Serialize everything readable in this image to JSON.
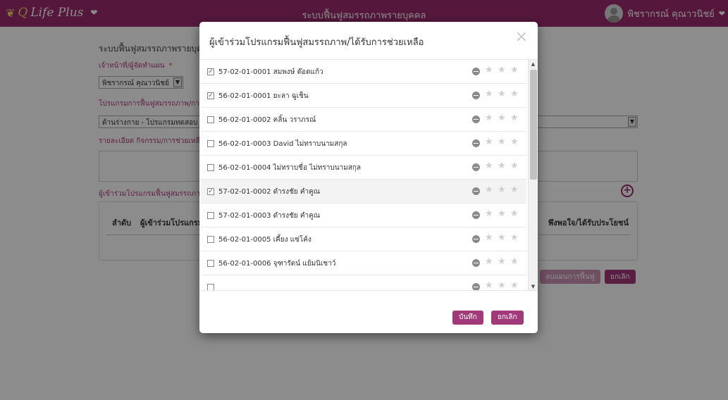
{
  "brand": {
    "name": "QLife Plus",
    "q": "Q",
    "rest": "Life Plus"
  },
  "header": {
    "app_title": "ระบบฟื้นฟูสมรรถภาพรายบุคคล",
    "user_name": "พิชรากรณ์ คุณาวนิชย์"
  },
  "form": {
    "heading": "ระบบฟื้นฟูสมรรถภาพรายบุค",
    "officer_label": "เจ้าหน้าที่/ผู้จัดทำแผน",
    "required_mark": "*",
    "officer_value": "พิชรากรณ์ คุณาวนิชย์",
    "program_label": "โปรแกรมการฟื้นฟูสมรรถภาพ/การช",
    "program_value": "ด้านร่างกาย - โปรแกรมทดสอบ",
    "detail_label": "รายละเอียด กิจกรรม/การช่วยเหลือ",
    "participants_label": "ผู้เข้าร่วมโปรแกรมฟื้นฟูสมรรถภา",
    "table": {
      "col_index": "ลำดับ",
      "col_participant": "ผู้เข้าร่วมโปรแกรมฟ",
      "col_satisfaction": "พึงพอใจ/ได้รับประโยชน์"
    },
    "save_plan_label": "ลบแผนการฟื้นฟู",
    "cancel_label": "ยกเลิก"
  },
  "modal": {
    "title": "ผู้เข้าร่วมโปรแกรมฟื้นฟูสมรรถภาพ/ได้รับการช่วยเหลือ",
    "close_symbol": "×",
    "save_label": "บันทึก",
    "cancel_label": "ยกเลิก",
    "rows": [
      {
        "label": "57-02-01-0001 สมพงษ์ ต๊อดแก้ว",
        "checked": true,
        "selected": false
      },
      {
        "label": "56-02-01-0001 ยะลา ฉูเช็น",
        "checked": true,
        "selected": false
      },
      {
        "label": "56-02-01-0002 คลิ้น วราภรณ์",
        "checked": false,
        "selected": false
      },
      {
        "label": "56-02-01-0003 David ไม่ทราบนามสกุล",
        "checked": false,
        "selected": false
      },
      {
        "label": "56-02-01-0004 ไม่ทราบชื่อ ไม่ทราบนามสกุล",
        "checked": false,
        "selected": false
      },
      {
        "label": "57-02-01-0002 ดำรงชัย คำคูณ",
        "checked": true,
        "selected": true
      },
      {
        "label": "57-02-01-0003 ดำรงชัย คำคูณ",
        "checked": false,
        "selected": false
      },
      {
        "label": "56-02-01-0005 เคี้ยง แซ่โค้ง",
        "checked": false,
        "selected": false
      },
      {
        "label": "56-02-01-0006 จุฑารัตน์ แย้มนิเชาว์",
        "checked": false,
        "selected": false
      },
      {
        "label": "",
        "checked": false,
        "selected": false
      }
    ]
  },
  "icons": {
    "brand": "leaf-icon",
    "brand_menu": "chevron-down-icon",
    "user_menu": "chevron-down-icon",
    "row_remove": "minus-circle-icon",
    "row_rating": "star-icon",
    "add": "plus-circle-icon"
  },
  "colors": {
    "accent": "#9b2d6e",
    "button": "#a23a7a"
  }
}
